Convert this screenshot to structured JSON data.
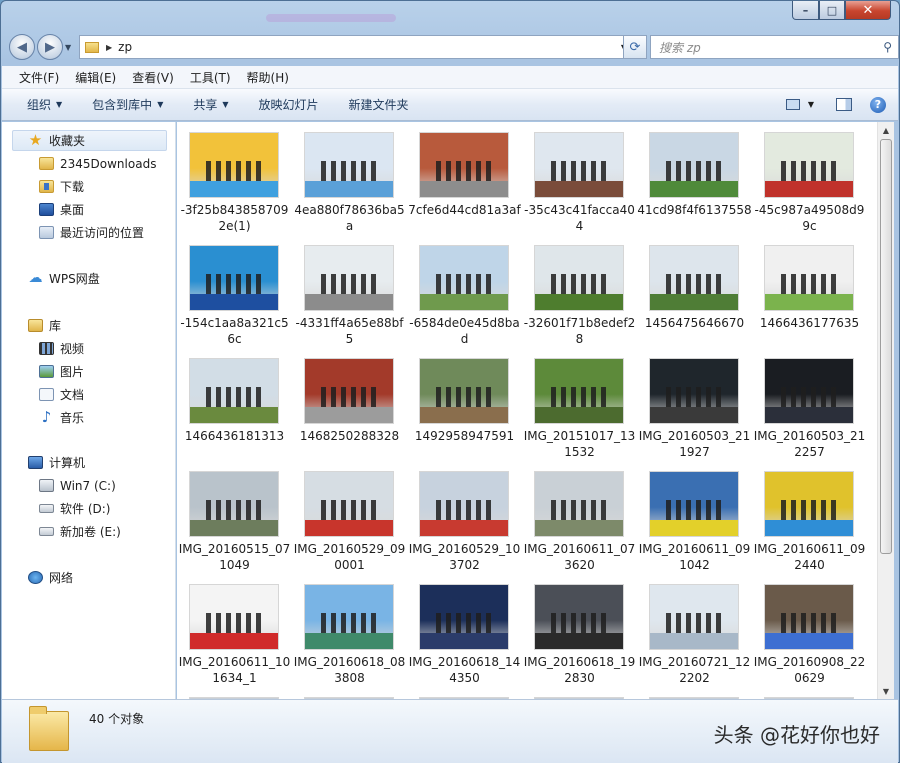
{
  "window": {
    "caption_buttons": {
      "minimize": "–",
      "maximize": "□",
      "close": "✕"
    }
  },
  "navigation": {
    "back_icon": "back-arrow-icon",
    "forward_icon": "forward-arrow-icon",
    "address_path": "zp",
    "search_placeholder": "搜索 zp"
  },
  "menubar": [
    "文件(F)",
    "编辑(E)",
    "查看(V)",
    "工具(T)",
    "帮助(H)"
  ],
  "toolbar": {
    "organize": "组织",
    "include_in_library": "包含到库中",
    "share": "共享",
    "slideshow": "放映幻灯片",
    "new_folder": "新建文件夹"
  },
  "sidebar": {
    "favorites": "收藏夹",
    "downloads_2345": "2345Downloads",
    "downloads": "下载",
    "desktop": "桌面",
    "recent": "最近访问的位置",
    "wps": "WPS网盘",
    "libraries": "库",
    "videos": "视频",
    "pictures": "图片",
    "documents": "文档",
    "music": "音乐",
    "computer": "计算机",
    "drive_c": "Win7 (C:)",
    "drive_d": "软件 (D:)",
    "drive_e": "新加卷 (E:)",
    "network": "网络"
  },
  "files": [
    {
      "name": "-3f25b8438587092e(1)",
      "sky": "#f2c23a",
      "ground": "#3fa0df"
    },
    {
      "name": "4ea880f78636ba5a",
      "sky": "#dbe6f2",
      "ground": "#5aa0d8"
    },
    {
      "name": "7cfe6d44cd81a3af",
      "sky": "#b85a3c",
      "ground": "#8d8d8d"
    },
    {
      "name": "-35c43c41facca404",
      "sky": "#dfe7ef",
      "ground": "#7a4c3a"
    },
    {
      "name": "41cd98f4f6137558",
      "sky": "#c9d7e4",
      "ground": "#4f8a3a"
    },
    {
      "name": "-45c987a49508d99c",
      "sky": "#e3eadf",
      "ground": "#c0322b"
    },
    {
      "name": "-154c1aa8a321c56c",
      "sky": "#2a8fd1",
      "ground": "#1e4fa0"
    },
    {
      "name": "-4331ff4a65e88bf5",
      "sky": "#e7ecef",
      "ground": "#8c8c8c"
    },
    {
      "name": "-6584de0e45d8bad",
      "sky": "#bfd5e8",
      "ground": "#6f9a4d"
    },
    {
      "name": "-32601f71b8edef28",
      "sky": "#dfe6ea",
      "ground": "#4e7d2e"
    },
    {
      "name": "1456475646670",
      "sky": "#dde5ec",
      "ground": "#4f7d36"
    },
    {
      "name": "1466436177635",
      "sky": "#f0f0f0",
      "ground": "#7bb34d"
    },
    {
      "name": "1466436181313",
      "sky": "#d2dde6",
      "ground": "#6a8a3e"
    },
    {
      "name": "1468250288328",
      "sky": "#a33a2a",
      "ground": "#9c9c9c"
    },
    {
      "name": "1492958947591",
      "sky": "#6f8a5a",
      "ground": "#8a6e4d"
    },
    {
      "name": "IMG_20151017_131532",
      "sky": "#5d8a3a",
      "ground": "#4c6b2f"
    },
    {
      "name": "IMG_20160503_211927",
      "sky": "#1f262c",
      "ground": "#3a3a3a"
    },
    {
      "name": "IMG_20160503_212257",
      "sky": "#1a1d22",
      "ground": "#2b2f3a"
    },
    {
      "name": "IMG_20160515_071049",
      "sky": "#b9c3cb",
      "ground": "#6d7d5d"
    },
    {
      "name": "IMG_20160529_090001",
      "sky": "#d6dde3",
      "ground": "#c8352c"
    },
    {
      "name": "IMG_20160529_103702",
      "sky": "#c7d2de",
      "ground": "#c83a30"
    },
    {
      "name": "IMG_20160611_073620",
      "sky": "#c9d0d6",
      "ground": "#7d8a6a"
    },
    {
      "name": "IMG_20160611_091042",
      "sky": "#3a6fb2",
      "ground": "#e3d02a"
    },
    {
      "name": "IMG_20160611_092440",
      "sky": "#e0c22c",
      "ground": "#2f8ed6"
    },
    {
      "name": "IMG_20160611_101634_1",
      "sky": "#f4f4f4",
      "ground": "#d02a2a"
    },
    {
      "name": "IMG_20160618_083808",
      "sky": "#79b4e5",
      "ground": "#3f8a6a"
    },
    {
      "name": "IMG_20160618_144350",
      "sky": "#1c2f5a",
      "ground": "#2b3c6a"
    },
    {
      "name": "IMG_20160618_192830",
      "sky": "#4b4f57",
      "ground": "#2a2a2a"
    },
    {
      "name": "IMG_20160721_122202",
      "sky": "#dfe7ee",
      "ground": "#a8b8c8"
    },
    {
      "name": "IMG_20160908_220629",
      "sky": "#6a5a4a",
      "ground": "#3d6fd2"
    }
  ],
  "status": {
    "count": "40 个对象"
  },
  "watermark": "头条 @花好你也好"
}
